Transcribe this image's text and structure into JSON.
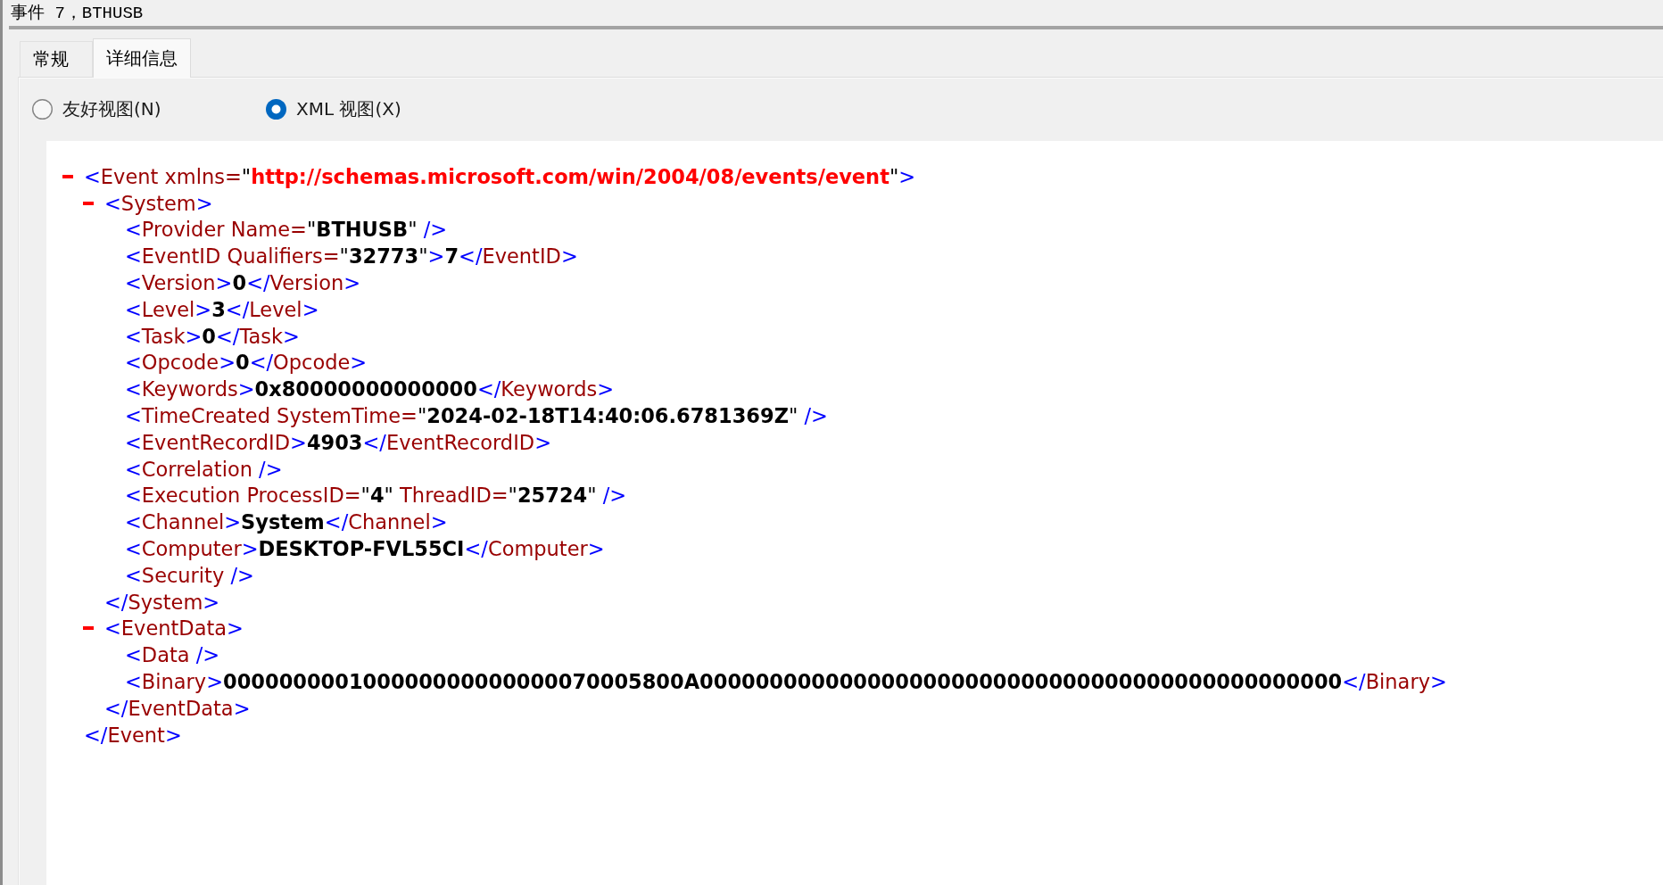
{
  "window": {
    "title": "事件 7，BTHUSB"
  },
  "tabs": [
    {
      "label": "常规",
      "selected": false
    },
    {
      "label": "详细信息",
      "selected": true
    }
  ],
  "view_options": [
    {
      "label": "友好视图(N)",
      "selected": false
    },
    {
      "label": "XML 视图(X)",
      "selected": true
    }
  ],
  "xml_document": {
    "expanded": true,
    "line": [
      {
        "kind": "markup",
        "text": "<"
      },
      {
        "kind": "name",
        "text": "Event xmlns="
      },
      {
        "kind": "plain",
        "text": "\""
      },
      {
        "kind": "namespace",
        "text": "http://schemas.microsoft.com/win/2004/08/events/event"
      },
      {
        "kind": "plain",
        "text": "\""
      },
      {
        "kind": "markup",
        "text": ">"
      }
    ],
    "children": [
      {
        "expanded": true,
        "line": [
          {
            "kind": "markup",
            "text": "<"
          },
          {
            "kind": "name",
            "text": "System"
          },
          {
            "kind": "markup",
            "text": ">"
          }
        ],
        "children": [
          {
            "line": [
              {
                "kind": "markup",
                "text": "<"
              },
              {
                "kind": "name",
                "text": "Provider Name="
              },
              {
                "kind": "plain",
                "text": "\""
              },
              {
                "kind": "value",
                "text": "BTHUSB"
              },
              {
                "kind": "plain",
                "text": "\""
              },
              {
                "kind": "markup",
                "text": " />"
              }
            ]
          },
          {
            "line": [
              {
                "kind": "markup",
                "text": "<"
              },
              {
                "kind": "name",
                "text": "EventID Qualifiers="
              },
              {
                "kind": "plain",
                "text": "\""
              },
              {
                "kind": "value",
                "text": "32773"
              },
              {
                "kind": "plain",
                "text": "\""
              },
              {
                "kind": "markup",
                "text": ">"
              },
              {
                "kind": "value",
                "text": "7"
              },
              {
                "kind": "markup",
                "text": "</"
              },
              {
                "kind": "name",
                "text": "EventID"
              },
              {
                "kind": "markup",
                "text": ">"
              }
            ]
          },
          {
            "line": [
              {
                "kind": "markup",
                "text": "<"
              },
              {
                "kind": "name",
                "text": "Version"
              },
              {
                "kind": "markup",
                "text": ">"
              },
              {
                "kind": "value",
                "text": "0"
              },
              {
                "kind": "markup",
                "text": "</"
              },
              {
                "kind": "name",
                "text": "Version"
              },
              {
                "kind": "markup",
                "text": ">"
              }
            ]
          },
          {
            "line": [
              {
                "kind": "markup",
                "text": "<"
              },
              {
                "kind": "name",
                "text": "Level"
              },
              {
                "kind": "markup",
                "text": ">"
              },
              {
                "kind": "value",
                "text": "3"
              },
              {
                "kind": "markup",
                "text": "</"
              },
              {
                "kind": "name",
                "text": "Level"
              },
              {
                "kind": "markup",
                "text": ">"
              }
            ]
          },
          {
            "line": [
              {
                "kind": "markup",
                "text": "<"
              },
              {
                "kind": "name",
                "text": "Task"
              },
              {
                "kind": "markup",
                "text": ">"
              },
              {
                "kind": "value",
                "text": "0"
              },
              {
                "kind": "markup",
                "text": "</"
              },
              {
                "kind": "name",
                "text": "Task"
              },
              {
                "kind": "markup",
                "text": ">"
              }
            ]
          },
          {
            "line": [
              {
                "kind": "markup",
                "text": "<"
              },
              {
                "kind": "name",
                "text": "Opcode"
              },
              {
                "kind": "markup",
                "text": ">"
              },
              {
                "kind": "value",
                "text": "0"
              },
              {
                "kind": "markup",
                "text": "</"
              },
              {
                "kind": "name",
                "text": "Opcode"
              },
              {
                "kind": "markup",
                "text": ">"
              }
            ]
          },
          {
            "line": [
              {
                "kind": "markup",
                "text": "<"
              },
              {
                "kind": "name",
                "text": "Keywords"
              },
              {
                "kind": "markup",
                "text": ">"
              },
              {
                "kind": "value",
                "text": "0x80000000000000"
              },
              {
                "kind": "markup",
                "text": "</"
              },
              {
                "kind": "name",
                "text": "Keywords"
              },
              {
                "kind": "markup",
                "text": ">"
              }
            ]
          },
          {
            "line": [
              {
                "kind": "markup",
                "text": "<"
              },
              {
                "kind": "name",
                "text": "TimeCreated SystemTime="
              },
              {
                "kind": "plain",
                "text": "\""
              },
              {
                "kind": "value",
                "text": "2024-02-18T14:40:06.6781369Z"
              },
              {
                "kind": "plain",
                "text": "\""
              },
              {
                "kind": "markup",
                "text": " />"
              }
            ]
          },
          {
            "line": [
              {
                "kind": "markup",
                "text": "<"
              },
              {
                "kind": "name",
                "text": "EventRecordID"
              },
              {
                "kind": "markup",
                "text": ">"
              },
              {
                "kind": "value",
                "text": "4903"
              },
              {
                "kind": "markup",
                "text": "</"
              },
              {
                "kind": "name",
                "text": "EventRecordID"
              },
              {
                "kind": "markup",
                "text": ">"
              }
            ]
          },
          {
            "line": [
              {
                "kind": "markup",
                "text": "<"
              },
              {
                "kind": "name",
                "text": "Correlation"
              },
              {
                "kind": "markup",
                "text": " />"
              }
            ]
          },
          {
            "line": [
              {
                "kind": "markup",
                "text": "<"
              },
              {
                "kind": "name",
                "text": "Execution ProcessID="
              },
              {
                "kind": "plain",
                "text": "\""
              },
              {
                "kind": "value",
                "text": "4"
              },
              {
                "kind": "plain",
                "text": "\""
              },
              {
                "kind": "name",
                "text": " ThreadID="
              },
              {
                "kind": "plain",
                "text": "\""
              },
              {
                "kind": "value",
                "text": "25724"
              },
              {
                "kind": "plain",
                "text": "\""
              },
              {
                "kind": "markup",
                "text": " />"
              }
            ]
          },
          {
            "line": [
              {
                "kind": "markup",
                "text": "<"
              },
              {
                "kind": "name",
                "text": "Channel"
              },
              {
                "kind": "markup",
                "text": ">"
              },
              {
                "kind": "value",
                "text": "System"
              },
              {
                "kind": "markup",
                "text": "</"
              },
              {
                "kind": "name",
                "text": "Channel"
              },
              {
                "kind": "markup",
                "text": ">"
              }
            ]
          },
          {
            "line": [
              {
                "kind": "markup",
                "text": "<"
              },
              {
                "kind": "name",
                "text": "Computer"
              },
              {
                "kind": "markup",
                "text": ">"
              },
              {
                "kind": "value",
                "text": "DESKTOP-FVL55CI"
              },
              {
                "kind": "markup",
                "text": "</"
              },
              {
                "kind": "name",
                "text": "Computer"
              },
              {
                "kind": "markup",
                "text": ">"
              }
            ]
          },
          {
            "line": [
              {
                "kind": "markup",
                "text": "<"
              },
              {
                "kind": "name",
                "text": "Security"
              },
              {
                "kind": "markup",
                "text": " />"
              }
            ]
          }
        ],
        "closing_line": [
          {
            "kind": "markup",
            "text": "</"
          },
          {
            "kind": "name",
            "text": "System"
          },
          {
            "kind": "markup",
            "text": ">"
          }
        ]
      },
      {
        "expanded": true,
        "line": [
          {
            "kind": "markup",
            "text": "<"
          },
          {
            "kind": "name",
            "text": "EventData"
          },
          {
            "kind": "markup",
            "text": ">"
          }
        ],
        "children": [
          {
            "line": [
              {
                "kind": "markup",
                "text": "<"
              },
              {
                "kind": "name",
                "text": "Data"
              },
              {
                "kind": "markup",
                "text": " />"
              }
            ]
          },
          {
            "line": [
              {
                "kind": "markup",
                "text": "<"
              },
              {
                "kind": "name",
                "text": "Binary"
              },
              {
                "kind": "markup",
                "text": ">"
              },
              {
                "kind": "value",
                "text": "000000000100000000000000070005800A0000000000000000000000000000000000000000000000"
              },
              {
                "kind": "markup",
                "text": "</"
              },
              {
                "kind": "name",
                "text": "Binary"
              },
              {
                "kind": "markup",
                "text": ">"
              }
            ]
          }
        ],
        "closing_line": [
          {
            "kind": "markup",
            "text": "</"
          },
          {
            "kind": "name",
            "text": "EventData"
          },
          {
            "kind": "markup",
            "text": ">"
          }
        ]
      }
    ],
    "closing_line": [
      {
        "kind": "markup",
        "text": "</"
      },
      {
        "kind": "name",
        "text": "Event"
      },
      {
        "kind": "markup",
        "text": ">"
      }
    ]
  }
}
